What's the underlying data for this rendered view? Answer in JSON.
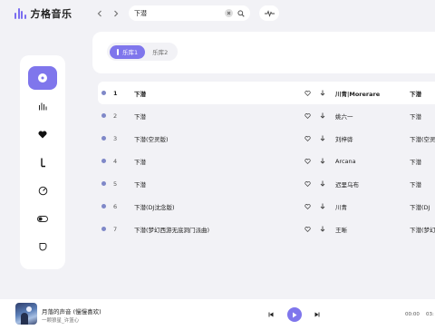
{
  "app": {
    "title": "方格音乐",
    "logo_icon": "music-bars-icon"
  },
  "search": {
    "value": "下潜",
    "placeholder": ""
  },
  "tabs": [
    {
      "label": "乐库1",
      "active": true
    },
    {
      "label": "乐库2",
      "active": false
    }
  ],
  "sidebar": {
    "items": [
      {
        "icon": "disc-icon",
        "active": true
      },
      {
        "icon": "chart-bars-icon",
        "active": false
      },
      {
        "icon": "heart-icon",
        "active": false
      },
      {
        "icon": "download-icon",
        "active": false
      },
      {
        "icon": "gauge-icon",
        "active": false
      },
      {
        "icon": "toggle-icon",
        "active": false
      },
      {
        "icon": "leaf-icon",
        "active": false
      }
    ]
  },
  "songs": [
    {
      "num": "1",
      "title": "下潜",
      "artist": "川青|Morerare",
      "album": "下潜"
    },
    {
      "num": "2",
      "title": "下潜",
      "artist": "姚六一",
      "album": "下潜"
    },
    {
      "num": "3",
      "title": "下潜(空灵版)",
      "artist": "刘梓骅",
      "album": "下潜(空灵"
    },
    {
      "num": "4",
      "title": "下潜",
      "artist": "Arcana",
      "album": "下潜"
    },
    {
      "num": "5",
      "title": "下潜",
      "artist": "迟里乌布",
      "album": "下潜"
    },
    {
      "num": "6",
      "title": "下潜(DJ沈念版)",
      "artist": "川青",
      "album": "下潜(DJ"
    },
    {
      "num": "7",
      "title": "下潜(梦幻西游无底洞门派曲)",
      "artist": "王晰",
      "album": "下潜(梦幻"
    }
  ],
  "player": {
    "song": "月落的声音 (慢慢喜欢)",
    "artist": "一颗狼星_许篮心",
    "time_current": "00:00",
    "time_total": "03:"
  },
  "colors": {
    "accent": "#7f76ec",
    "background": "#f2f2f6",
    "dot": "#7f88c8"
  }
}
